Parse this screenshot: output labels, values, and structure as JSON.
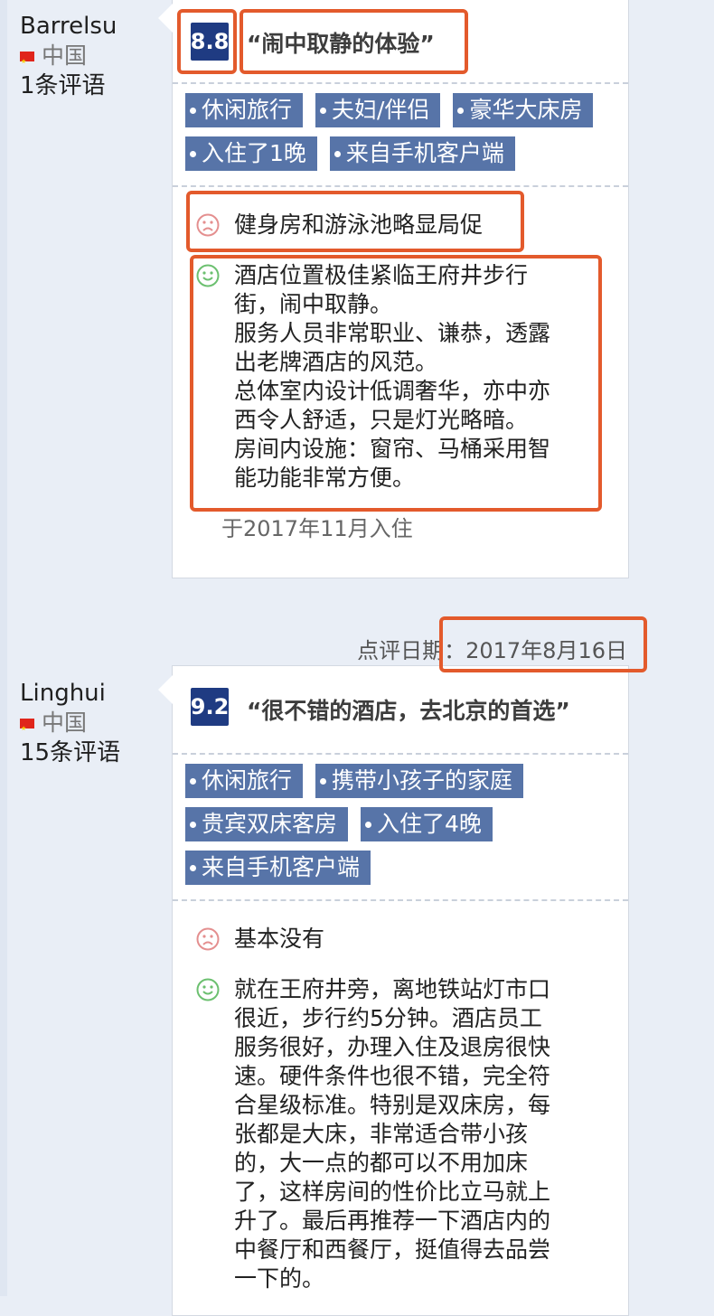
{
  "reviews": [
    {
      "name": "Barrelsu",
      "country": "中国",
      "review_count": "1条评语",
      "score": "8.8",
      "title": "“闹中取静的体验”",
      "tags": [
        "休闲旅行",
        "夫妇/伴侣",
        "豪华大床房",
        "入住了1晚",
        "来自手机客户端"
      ],
      "negative": "健身房和游泳池略显局促",
      "positive": "酒店位置极佳紧临王府井步行\n街，闹中取静。\n服务人员非常职业、谦恭，透露\n出老牌酒店的风范。\n总体室内设计低调奢华，亦中亦\n西令人舒适，只是灯光略暗。\n房间内设施：窗帘、马桶采用智\n能功能非常方便。",
      "stay": "于2017年11月入住"
    },
    {
      "date_label": "点评日期：",
      "date_value": "2017年8月16日",
      "name": "Linghui",
      "country": "中国",
      "review_count": "15条评语",
      "score": "9.2",
      "title": "“很不错的酒店，去北京的首选”",
      "tags": [
        "休闲旅行",
        "携带小孩子的家庭",
        "贵宾双床客房",
        "入住了4晚",
        "来自手机客户端"
      ],
      "negative": "基本没有",
      "positive": "就在王府井旁，离地铁站灯市口\n很近，步行约5分钟。酒店员工\n服务很好，办理入住及退房很快\n速。硬件条件也很不错，完全符\n合星级标准。特别是双床房，每\n张都是大床，非常适合带小孩\n的，大一点的都可以不用加床\n了，这样房间的性价比立马就上\n升了。最后再推荐一下酒店内的\n中餐厅和西餐厅，挺值得去品尝\n一下的。"
    }
  ],
  "colors": {
    "score_bg": "#1f3b82",
    "tag_bg": "#5774a8",
    "highlight": "#e35a2c",
    "sad": "#e48f8f",
    "happy": "#6cc070"
  },
  "icons": {
    "negative": "sad-face-icon",
    "positive": "happy-face-icon",
    "flag": "china-flag-icon"
  }
}
